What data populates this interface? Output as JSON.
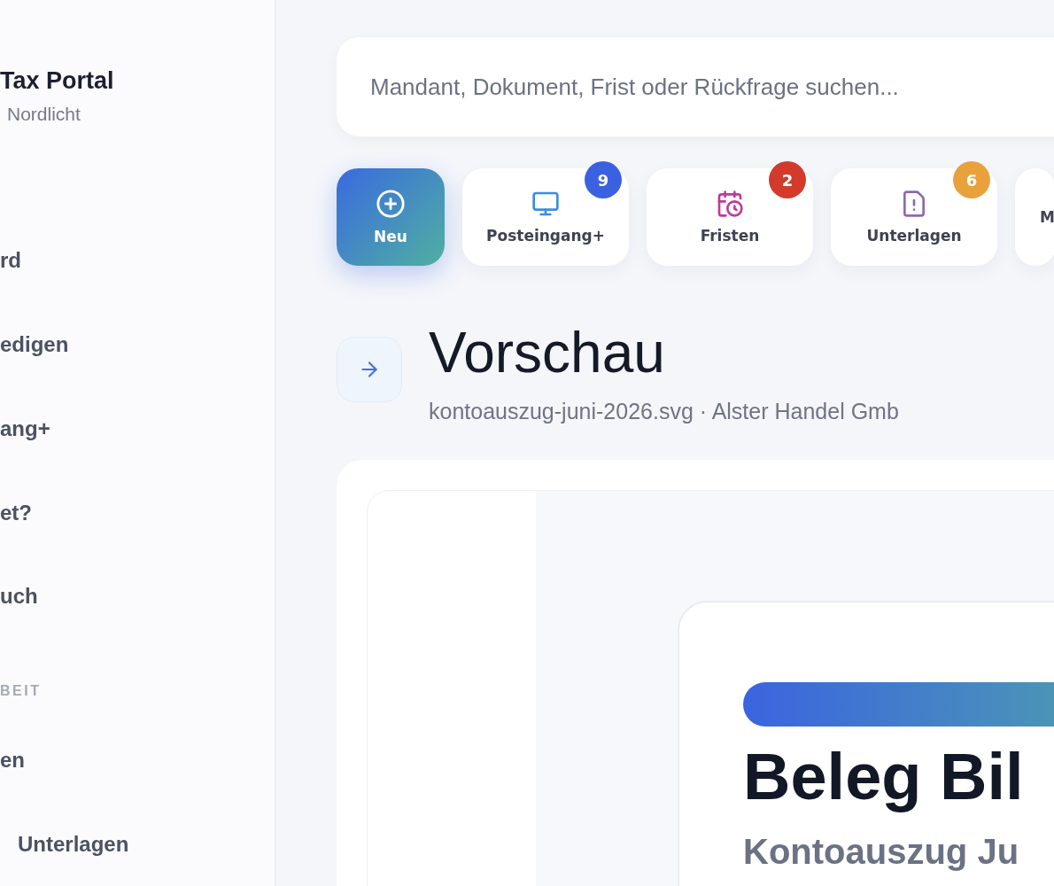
{
  "sidebar": {
    "brand": {
      "title": "Tax Portal",
      "subtitle": "Nordlicht"
    },
    "items": [
      {
        "label": "rd"
      },
      {
        "label": "edigen"
      },
      {
        "label": "ang+"
      },
      {
        "label": "et?"
      },
      {
        "label": "uch"
      }
    ],
    "section": {
      "label": "BEIT",
      "items": [
        {
          "label": "en",
          "indent": false
        },
        {
          "label": "Unterlagen",
          "indent": true
        }
      ]
    }
  },
  "search": {
    "placeholder": "Mandant, Dokument, Frist oder Rückfrage suchen..."
  },
  "quick_actions": [
    {
      "kind": "new",
      "label": "Neu"
    },
    {
      "kind": "inbox",
      "label": "Posteingang+",
      "badge": "9",
      "color": "#3a62e0"
    },
    {
      "kind": "calendar",
      "label": "Fristen",
      "badge": "2",
      "color": "#d23a2c"
    },
    {
      "kind": "document",
      "label": "Unterlagen",
      "badge": "6",
      "color": "#e9a23b"
    },
    {
      "kind": "more",
      "label": "M"
    }
  ],
  "header": {
    "title": "Vorschau",
    "subtitle": "kontoauszug-juni-2026.svg · Alster Handel Gmb"
  },
  "preview": {
    "title": "Beleg Bil",
    "subtitle": "Kontoauszug Ju"
  }
}
